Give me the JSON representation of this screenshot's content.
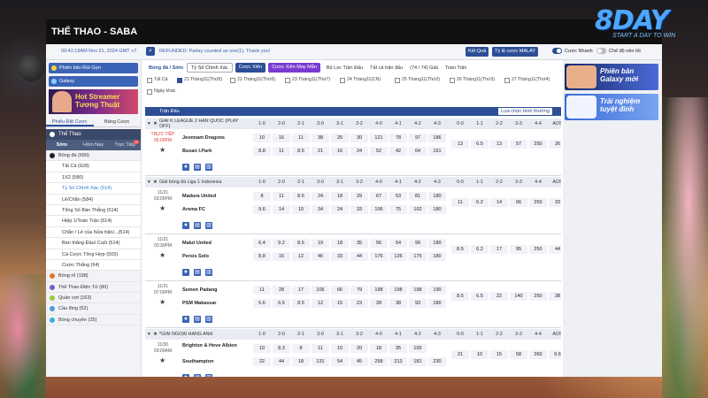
{
  "window": {
    "title": "THỂ THAO - SABA"
  },
  "logo": {
    "brand": "8DAY",
    "slogan": "START A DAY TO WIN"
  },
  "topbar": {
    "datetime": "09:42:19AM Nov 21, 2024 GMT +7",
    "news": "REFUNDED: Parlay counted as one(1), Thank you!",
    "btn_result": "Kết Quả",
    "btn_odds": "Tỷ lệ cược MALAY",
    "toggle_quick": "Cược Nhanh",
    "toggle_mode": "Chế độ nền tối"
  },
  "left": {
    "btn_change": "Phiên bản Rút Gọn",
    "btn_galaxy": "Galaxy",
    "promo": {
      "line1": "Hot Streamer",
      "line2": "Tương Thuật"
    },
    "tabs": [
      "Phiếu Đặt Cược",
      "Bảng Cược"
    ],
    "sport_header": "Thể Thao",
    "subtabs": [
      "Sớm",
      "Hôm Nay",
      "Trực Tiếp"
    ],
    "live_badge": "15",
    "items": [
      {
        "label": "Bóng đá (690)",
        "type": "main",
        "color": "#222"
      },
      {
        "label": "Tất Cả (628)",
        "type": "sub"
      },
      {
        "label": "1X2 (580)",
        "type": "sub"
      },
      {
        "label": "Tỷ Số Chính Xác (514)",
        "type": "sub",
        "sel": true
      },
      {
        "label": "Lẻ/Chẵn (584)",
        "type": "sub"
      },
      {
        "label": "Tổng Số Bàn Thắng (514)",
        "type": "sub"
      },
      {
        "label": "Hiệp 1/Toàn Trận (514)",
        "type": "sub"
      },
      {
        "label": "Chẵn / Lẻ của Nửa trận/...(514)",
        "type": "sub"
      },
      {
        "label": "Bàn thắng Đầu/ Cuối (514)",
        "type": "sub"
      },
      {
        "label": "Cá Cược Tổng Hợp (503)",
        "type": "sub"
      },
      {
        "label": "Cược Thắng (64)",
        "type": "sub"
      },
      {
        "label": "Bóng rổ (198)",
        "type": "main",
        "color": "#e2752a"
      },
      {
        "label": "Thể Thao Điện Tử (80)",
        "type": "main",
        "color": "#7a5acb"
      },
      {
        "label": "Quần vợt (163)",
        "type": "main",
        "color": "#9acb3a"
      },
      {
        "label": "Cầu lông (52)",
        "type": "main",
        "color": "#4a9ae2"
      },
      {
        "label": "Bóng chuyền (25)",
        "type": "main",
        "color": "#3ab0e2"
      }
    ]
  },
  "center": {
    "sport_title": "Bóng đá / Sớm",
    "market": "Tỷ Số Chính Xác",
    "btn_bet": "Cược Xiên",
    "btn_bet2": "Cược Xiên May Mắn",
    "filter": "Bộ Lọc Trận Đấu",
    "filter2": "Tất cả trận đấu",
    "count": "(74 / 74) Giải",
    "sort_label": "Toàn Trận",
    "dates": [
      "Tất Cả",
      "21 Tháng11(Thứ5)",
      "22 Tháng11(Thứ6)",
      "23 Tháng11(Thứ7)",
      "24 Tháng11(CN)",
      "25 Tháng11(Thứ2)",
      "26 Tháng11(Thứ3)",
      "27 Tháng11(Thứ4)",
      "Ngày khác"
    ],
    "table_head": "Trận Đấu",
    "sort": "Lựa chọn bình thường",
    "cols": [
      "1-0",
      "2-0",
      "2-1",
      "3-0",
      "3-1",
      "3-2",
      "4-0",
      "4-1",
      "4-2",
      "4-3",
      "0-0",
      "1-1",
      "2-2",
      "3-3",
      "4-4",
      "AOS"
    ],
    "leagues": [
      {
        "name": "GIẢI K LEAGUE 2 HÀN QUỐC (PLAY OFF)",
        "matches": [
          {
            "time": "TRỰC TIẾP",
            "time2": "05:00PM",
            "live": true,
            "home": "Jeonnam Dragons",
            "away": "Busan I.Park",
            "r1": [
              "10",
              "16",
              "11",
              "38",
              "25",
              "30",
              "121",
              "78",
              "97",
              "186"
            ],
            "r2": [
              "8.8",
              "11",
              "8.5",
              "21",
              "16",
              "24",
              "52",
              "42",
              "64",
              "151"
            ],
            "d": [
              "13",
              "6.5",
              "13",
              "57",
              "250",
              "26"
            ]
          }
        ]
      },
      {
        "name": "Giải bóng đá Liga 1 Indonesia",
        "matches": [
          {
            "time": "11/21",
            "time2": "03:05PM",
            "home": "Madura United",
            "away": "Arema FC",
            "r1": [
              "8",
              "11",
              "8.5",
              "24",
              "18",
              "29",
              "67",
              "53",
              "81",
              "180"
            ],
            "r2": [
              "9.6",
              "14",
              "10",
              "34",
              "24",
              "33",
              "106",
              "75",
              "102",
              "180"
            ],
            "d": [
              "11",
              "6.2",
              "14",
              "66",
              "250",
              "33"
            ]
          },
          {
            "time": "11/21",
            "time2": "03:30PM",
            "home": "Malut United",
            "away": "Persis Solo",
            "r1": [
              "6.4",
              "9.2",
              "8.5",
              "19",
              "18",
              "35",
              "56",
              "54",
              "99",
              "180"
            ],
            "r2": [
              "8.8",
              "16",
              "12",
              "46",
              "33",
              "44",
              "176",
              "126",
              "175",
              "180"
            ],
            "d": [
              "8.5",
              "6.2",
              "17",
              "95",
              "250",
              "44"
            ]
          },
          {
            "time": "11/21",
            "time2": "07:00PM",
            "home": "Semen Padang",
            "away": "PSM Makassar",
            "r1": [
              "11",
              "28",
              "17",
              "106",
              "66",
              "79",
              "198",
              "198",
              "198",
              "190"
            ],
            "r2": [
              "5.6",
              "6.5",
              "8.5",
              "12",
              "15",
              "23",
              "28",
              "38",
              "93",
              "180"
            ],
            "d": [
              "8.5",
              "6.5",
              "22",
              "140",
              "250",
              "38"
            ]
          }
        ]
      },
      {
        "name": "*GIẢI NGOẠI HẠNG ANH",
        "matches": [
          {
            "time": "11/30",
            "time2": "03:00AM",
            "home": "Brighton & Hove Albion",
            "away": "Southampton",
            "r1": [
              "10",
              "8.3",
              "8",
              "11",
              "10",
              "20",
              "18",
              "35",
              "105",
              ""
            ],
            "r2": [
              "22",
              "44",
              "18",
              "131",
              "54",
              "45",
              "258",
              "213",
              "181",
              "230"
            ],
            "d": [
              "21",
              "10",
              "15",
              "58",
              "260",
              "9.6"
            ]
          }
        ]
      }
    ]
  },
  "right": {
    "ban1": {
      "l1": "Phiên bản",
      "l2": "Galaxy mới"
    },
    "ban2": {
      "l1": "Trải nghiệm",
      "l2": "tuyệt đỉnh"
    }
  }
}
